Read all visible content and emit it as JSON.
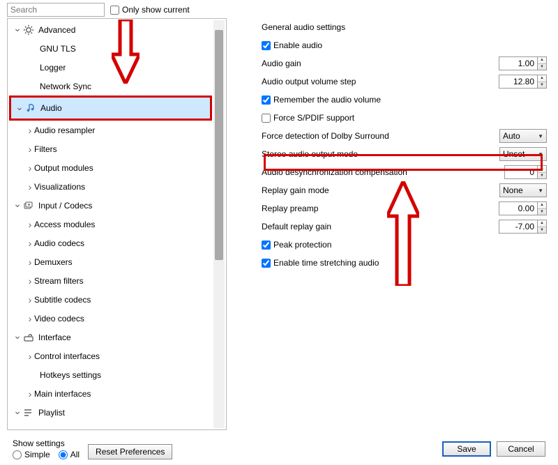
{
  "top": {
    "search_placeholder": "Search",
    "only_show_current": "Only show current"
  },
  "tree": {
    "advanced": "Advanced",
    "gnu_tls": "GNU TLS",
    "logger": "Logger",
    "network_sync": "Network Sync",
    "audio": "Audio",
    "audio_resampler": "Audio resampler",
    "filters": "Filters",
    "output_modules": "Output modules",
    "visualizations": "Visualizations",
    "input_codecs": "Input / Codecs",
    "access_modules": "Access modules",
    "audio_codecs": "Audio codecs",
    "demuxers": "Demuxers",
    "stream_filters": "Stream filters",
    "subtitle_codecs": "Subtitle codecs",
    "video_codecs": "Video codecs",
    "interface": "Interface",
    "control_interfaces": "Control interfaces",
    "hotkeys_settings": "Hotkeys settings",
    "main_interfaces": "Main interfaces",
    "playlist": "Playlist"
  },
  "section_title": "General audio settings",
  "settings": {
    "enable_audio": "Enable audio",
    "audio_gain_label": "Audio gain",
    "audio_gain_value": "1.00",
    "volume_step_label": "Audio output volume step",
    "volume_step_value": "12.80",
    "remember_volume": "Remember the audio volume",
    "force_spdif": "Force S/PDIF support",
    "dolby_label": "Force detection of Dolby Surround",
    "dolby_value": "Auto",
    "stereo_label": "Stereo audio output mode",
    "stereo_value": "Unset",
    "desync_label": "Audio desynchronization compensation",
    "desync_value": "0",
    "replay_mode_label": "Replay gain mode",
    "replay_mode_value": "None",
    "replay_preamp_label": "Replay preamp",
    "replay_preamp_value": "0.00",
    "default_replay_label": "Default replay gain",
    "default_replay_value": "-7.00",
    "peak_protection": "Peak protection",
    "time_stretching": "Enable time stretching audio"
  },
  "footer": {
    "show_settings": "Show settings",
    "simple": "Simple",
    "all": "All",
    "reset": "Reset Preferences",
    "save": "Save",
    "cancel": "Cancel"
  }
}
